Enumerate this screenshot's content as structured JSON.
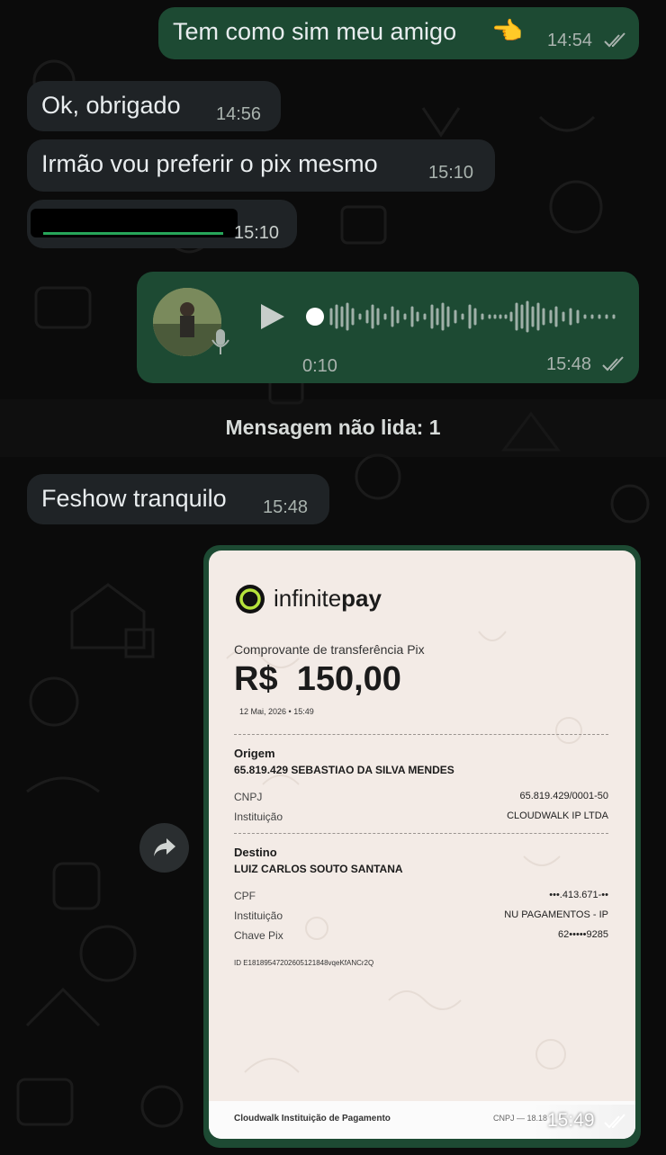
{
  "messages": {
    "m1": {
      "text": "Tem como sim meu amigo",
      "time": "14:54"
    },
    "m2": {
      "text": "Ok, obrigado",
      "time": "14:56"
    },
    "m3": {
      "text": "Irmão vou preferir o pix mesmo",
      "time": "15:10"
    },
    "m4": {
      "time": "15:10"
    },
    "voice": {
      "duration": "0:10",
      "time": "15:48"
    },
    "m5": {
      "text": "Feshow tranquilo",
      "time": "15:48"
    }
  },
  "unread_label": "Mensagem não lida: 1",
  "receipt": {
    "brand_light": "infinite",
    "brand_bold": "pay",
    "subtitle": "Comprovante de transferência Pix",
    "amount": "R$  150,00",
    "datetime": "12 Mai, 2026 • 15:49",
    "origem_title": "Origem",
    "origem_name": "65.819.429 SEBASTIAO DA SILVA MENDES",
    "cnpj_label": "CNPJ",
    "cnpj_value": "65.819.429/0001-50",
    "inst_label": "Instituição",
    "inst_value_origem": "CLOUDWALK IP LTDA",
    "destino_title": "Destino",
    "destino_name": "LUIZ CARLOS SOUTO SANTANA",
    "cpf_label": "CPF",
    "cpf_value": "•••.413.671-••",
    "inst_value_destino": "NU PAGAMENTOS - IP",
    "chave_label": "Chave Pix",
    "chave_value": "62•••••9285",
    "id_text": "ID E18189547202605121848vqeKfANCr2Q",
    "footer_left": "Cloudwalk Instituição de Pagamento",
    "footer_right": "CNPJ — 18.18",
    "time": "15:49"
  },
  "colors": {
    "outgoing": "#1d4a33",
    "incoming": "#1f2326",
    "background": "#0b0b0b"
  }
}
